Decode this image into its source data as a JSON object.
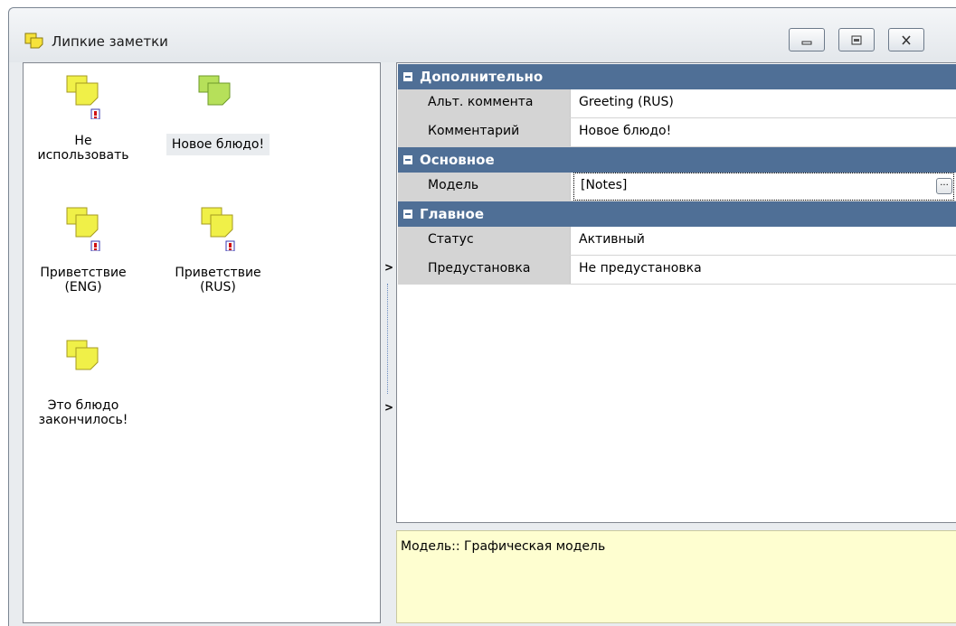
{
  "window": {
    "title": "Липкие заметки",
    "icon": "sticky-notes-icon"
  },
  "notes": [
    {
      "label": "Не использовать",
      "icon": "sticky-note-icon",
      "warning": true,
      "color": "#f0f048"
    },
    {
      "label": "Новое блюдо!",
      "icon": "sticky-note-icon",
      "warning": false,
      "color": "#b6e05a",
      "selected": true
    },
    {
      "label": "Приветствие (ENG)",
      "icon": "sticky-note-icon",
      "warning": true,
      "color": "#f0f048"
    },
    {
      "label": "Приветствие (RUS)",
      "icon": "sticky-note-icon",
      "warning": true,
      "color": "#f0f048"
    },
    {
      "label": "Это блюдо закончилось!",
      "icon": "sticky-note-icon",
      "warning": false,
      "color": "#f0f048"
    }
  ],
  "properties": {
    "categories": [
      {
        "name": "Дополнительно",
        "rows": [
          {
            "name": "Альт. коммента",
            "value": "Greeting (RUS)"
          },
          {
            "name": "Комментарий",
            "value": "Новое блюдо!"
          }
        ]
      },
      {
        "name": "Основное",
        "rows": [
          {
            "name": "Модель",
            "value": "[Notes]",
            "button": "..."
          }
        ]
      },
      {
        "name": "Главное",
        "rows": [
          {
            "name": "Статус",
            "value": "Активный"
          },
          {
            "name": "Предустановка",
            "value": "Не предустановка"
          }
        ]
      }
    ]
  },
  "description": "Модель:: Графическая модель",
  "colors": {
    "category_header": "#4f6f96",
    "description_bg": "#fefed0",
    "name_column_bg": "#d4d4d4"
  }
}
